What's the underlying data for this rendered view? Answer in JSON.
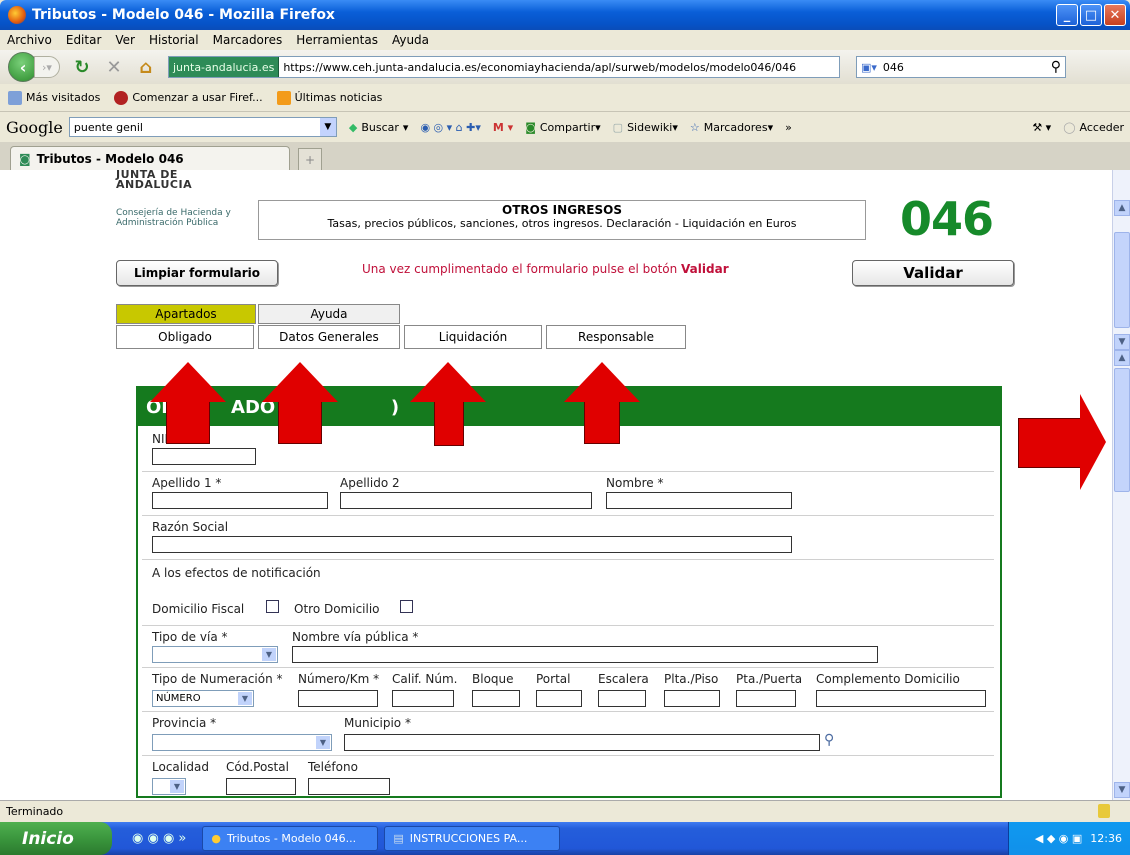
{
  "window": {
    "title": "Tributos - Modelo 046 - Mozilla Firefox"
  },
  "menu": [
    "Archivo",
    "Editar",
    "Ver",
    "Historial",
    "Marcadores",
    "Herramientas",
    "Ayuda"
  ],
  "nav": {
    "site_badge": "junta-andalucia.es",
    "url": "https://www.ceh.junta-andalucia.es/economiayhacienda/apl/surweb/modelos/modelo046/046",
    "search_value": "046"
  },
  "bookmarks": [
    "Más visitados",
    "Comenzar a usar Firef...",
    "Últimas noticias"
  ],
  "google_toolbar": {
    "logo": "Google",
    "search_value": "puente genil",
    "buscar": "Buscar",
    "compartir": "Compartir",
    "sidewiki": "Sidewiki",
    "marcadores": "Marcadores",
    "more": "»",
    "acceder": "Acceder"
  },
  "tab": {
    "title": "Tributos - Modelo 046"
  },
  "header": {
    "logo_line1": "JUNTA DE ANDALUCIA",
    "logo_line2": "Consejería de Hacienda y",
    "logo_line3": "Administración Pública",
    "title": "OTROS INGRESOS",
    "subtitle": "Tasas, precios públicos, sanciones, otros ingresos. Declaración - Liquidación en Euros",
    "model_number": "046"
  },
  "actions": {
    "clear": "Limpiar formulario",
    "notice_prefix": "Una vez cumplimentado el formulario pulse el botón",
    "notice_bold": "Validar",
    "validate": "Validar"
  },
  "tabs": {
    "apartados": "Apartados",
    "ayuda": "Ayuda",
    "sections": [
      "Obligado",
      "Datos Generales",
      "Liquidación",
      "Responsable"
    ]
  },
  "form": {
    "heading_left": "OB",
    "heading_mid": "ADO AL",
    "heading_right": ")",
    "nif": "NIF *",
    "apellido1": "Apellido 1 *",
    "apellido2": "Apellido 2",
    "nombre": "Nombre *",
    "razon_social": "Razón Social",
    "notificacion": "A los efectos de notificación",
    "domicilio_fiscal": "Domicilio Fiscal",
    "otro_domicilio": "Otro Domicilio",
    "tipo_via": "Tipo de vía *",
    "nombre_via": "Nombre vía pública *",
    "tipo_numeracion": "Tipo de Numeración *",
    "tipo_numeracion_value": "NÚMERO",
    "numero_km": "Número/Km *",
    "calif_num": "Calif. Núm.",
    "bloque": "Bloque",
    "portal": "Portal",
    "escalera": "Escalera",
    "plta_piso": "Plta./Piso",
    "pta_puerta": "Pta./Puerta",
    "complemento": "Complemento Domicilio",
    "provincia": "Provincia *",
    "municipio": "Municipio *",
    "localidad": "Localidad",
    "cod_postal": "Cód.Postal",
    "telefono": "Teléfono"
  },
  "status": {
    "text": "Terminado"
  },
  "taskbar": {
    "start": "Inicio",
    "items": [
      "Tributos - Modelo 046...",
      "INSTRUCCIONES PA..."
    ],
    "clock": "12:36"
  },
  "colors": {
    "accent_green": "#157a1e",
    "arrow_red": "#e00000",
    "notice_red": "#c0103a",
    "tab_active": "#c8c800"
  }
}
